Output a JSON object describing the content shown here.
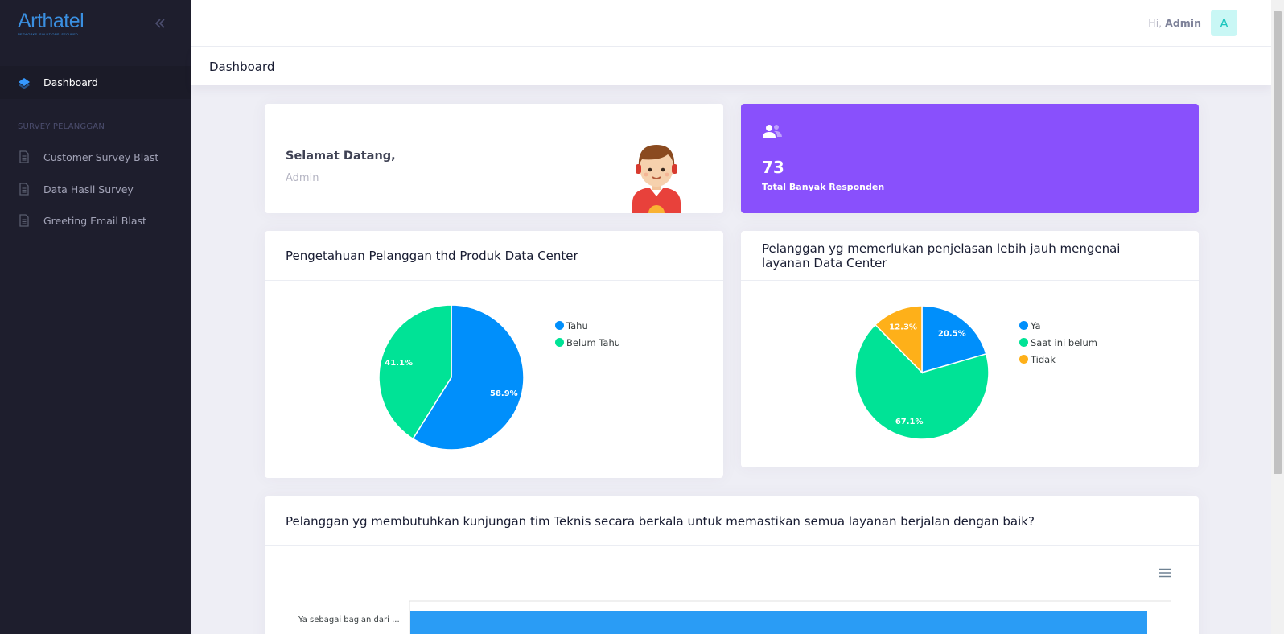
{
  "app": {
    "brand": "Arthatel",
    "brand_tagline": "NETWORKS. SOLUTIONS. SECURED."
  },
  "sidebar": {
    "active_item": {
      "label": "Dashboard",
      "icon": "layers-icon"
    },
    "section_title": "SURVEY PELANGGAN",
    "items": [
      {
        "label": "Customer Survey Blast",
        "icon": "document-icon"
      },
      {
        "label": "Data Hasil Survey",
        "icon": "document-icon"
      },
      {
        "label": "Greeting Email Blast",
        "icon": "document-icon"
      }
    ]
  },
  "header": {
    "greeting": "Hi,",
    "user_name": "Admin",
    "avatar_letter": "A"
  },
  "subheader": {
    "title": "Dashboard"
  },
  "welcome_card": {
    "title": "Selamat Datang,",
    "name": "Admin"
  },
  "stat_card": {
    "value": "73",
    "label": "Total Banyak Responden",
    "icon": "users-icon",
    "color": "#8950fc"
  },
  "charts": {
    "knowledge": {
      "title": "Pengetahuan Pelanggan thd Produk Data Center",
      "labels": [
        "58.9%",
        "41.1%"
      ]
    },
    "explanation": {
      "title_line1": "Pelanggan yg memerlukan penjelasan lebih jauh mengenai",
      "title_line2": "layanan Data Center",
      "labels": [
        "20.5%",
        "67.1%",
        "12.3%"
      ]
    },
    "visit": {
      "title": "Pelanggan yg membutuhkan kunjungan tim Teknis secara berkala untuk memastikan semua layanan berjalan dengan baik?",
      "category_label": "Ya sebagai bagian dari ..."
    }
  },
  "chart_data": [
    {
      "type": "pie",
      "title": "Pengetahuan Pelanggan thd Produk Data Center",
      "categories": [
        "Tahu",
        "Belum Tahu"
      ],
      "values": [
        58.9,
        41.1
      ],
      "colors": [
        "#008ffb",
        "#00e396"
      ],
      "legend": "right"
    },
    {
      "type": "pie",
      "title": "Pelanggan yg memerlukan penjelasan lebih jauh mengenai layanan Data Center",
      "categories": [
        "Ya",
        "Saat ini belum",
        "Tidak"
      ],
      "values": [
        20.5,
        67.1,
        12.3
      ],
      "colors": [
        "#008ffb",
        "#00e396",
        "#feb019"
      ],
      "legend": "right"
    },
    {
      "type": "bar",
      "title": "Pelanggan yg membutuhkan kunjungan tim Teknis secara berkala untuk memastikan semua layanan berjalan dengan baik?",
      "categories": [
        "Ya sebagai bagian dari ..."
      ],
      "orientation": "horizontal",
      "colors": [
        "#2a9cf5"
      ]
    }
  ]
}
